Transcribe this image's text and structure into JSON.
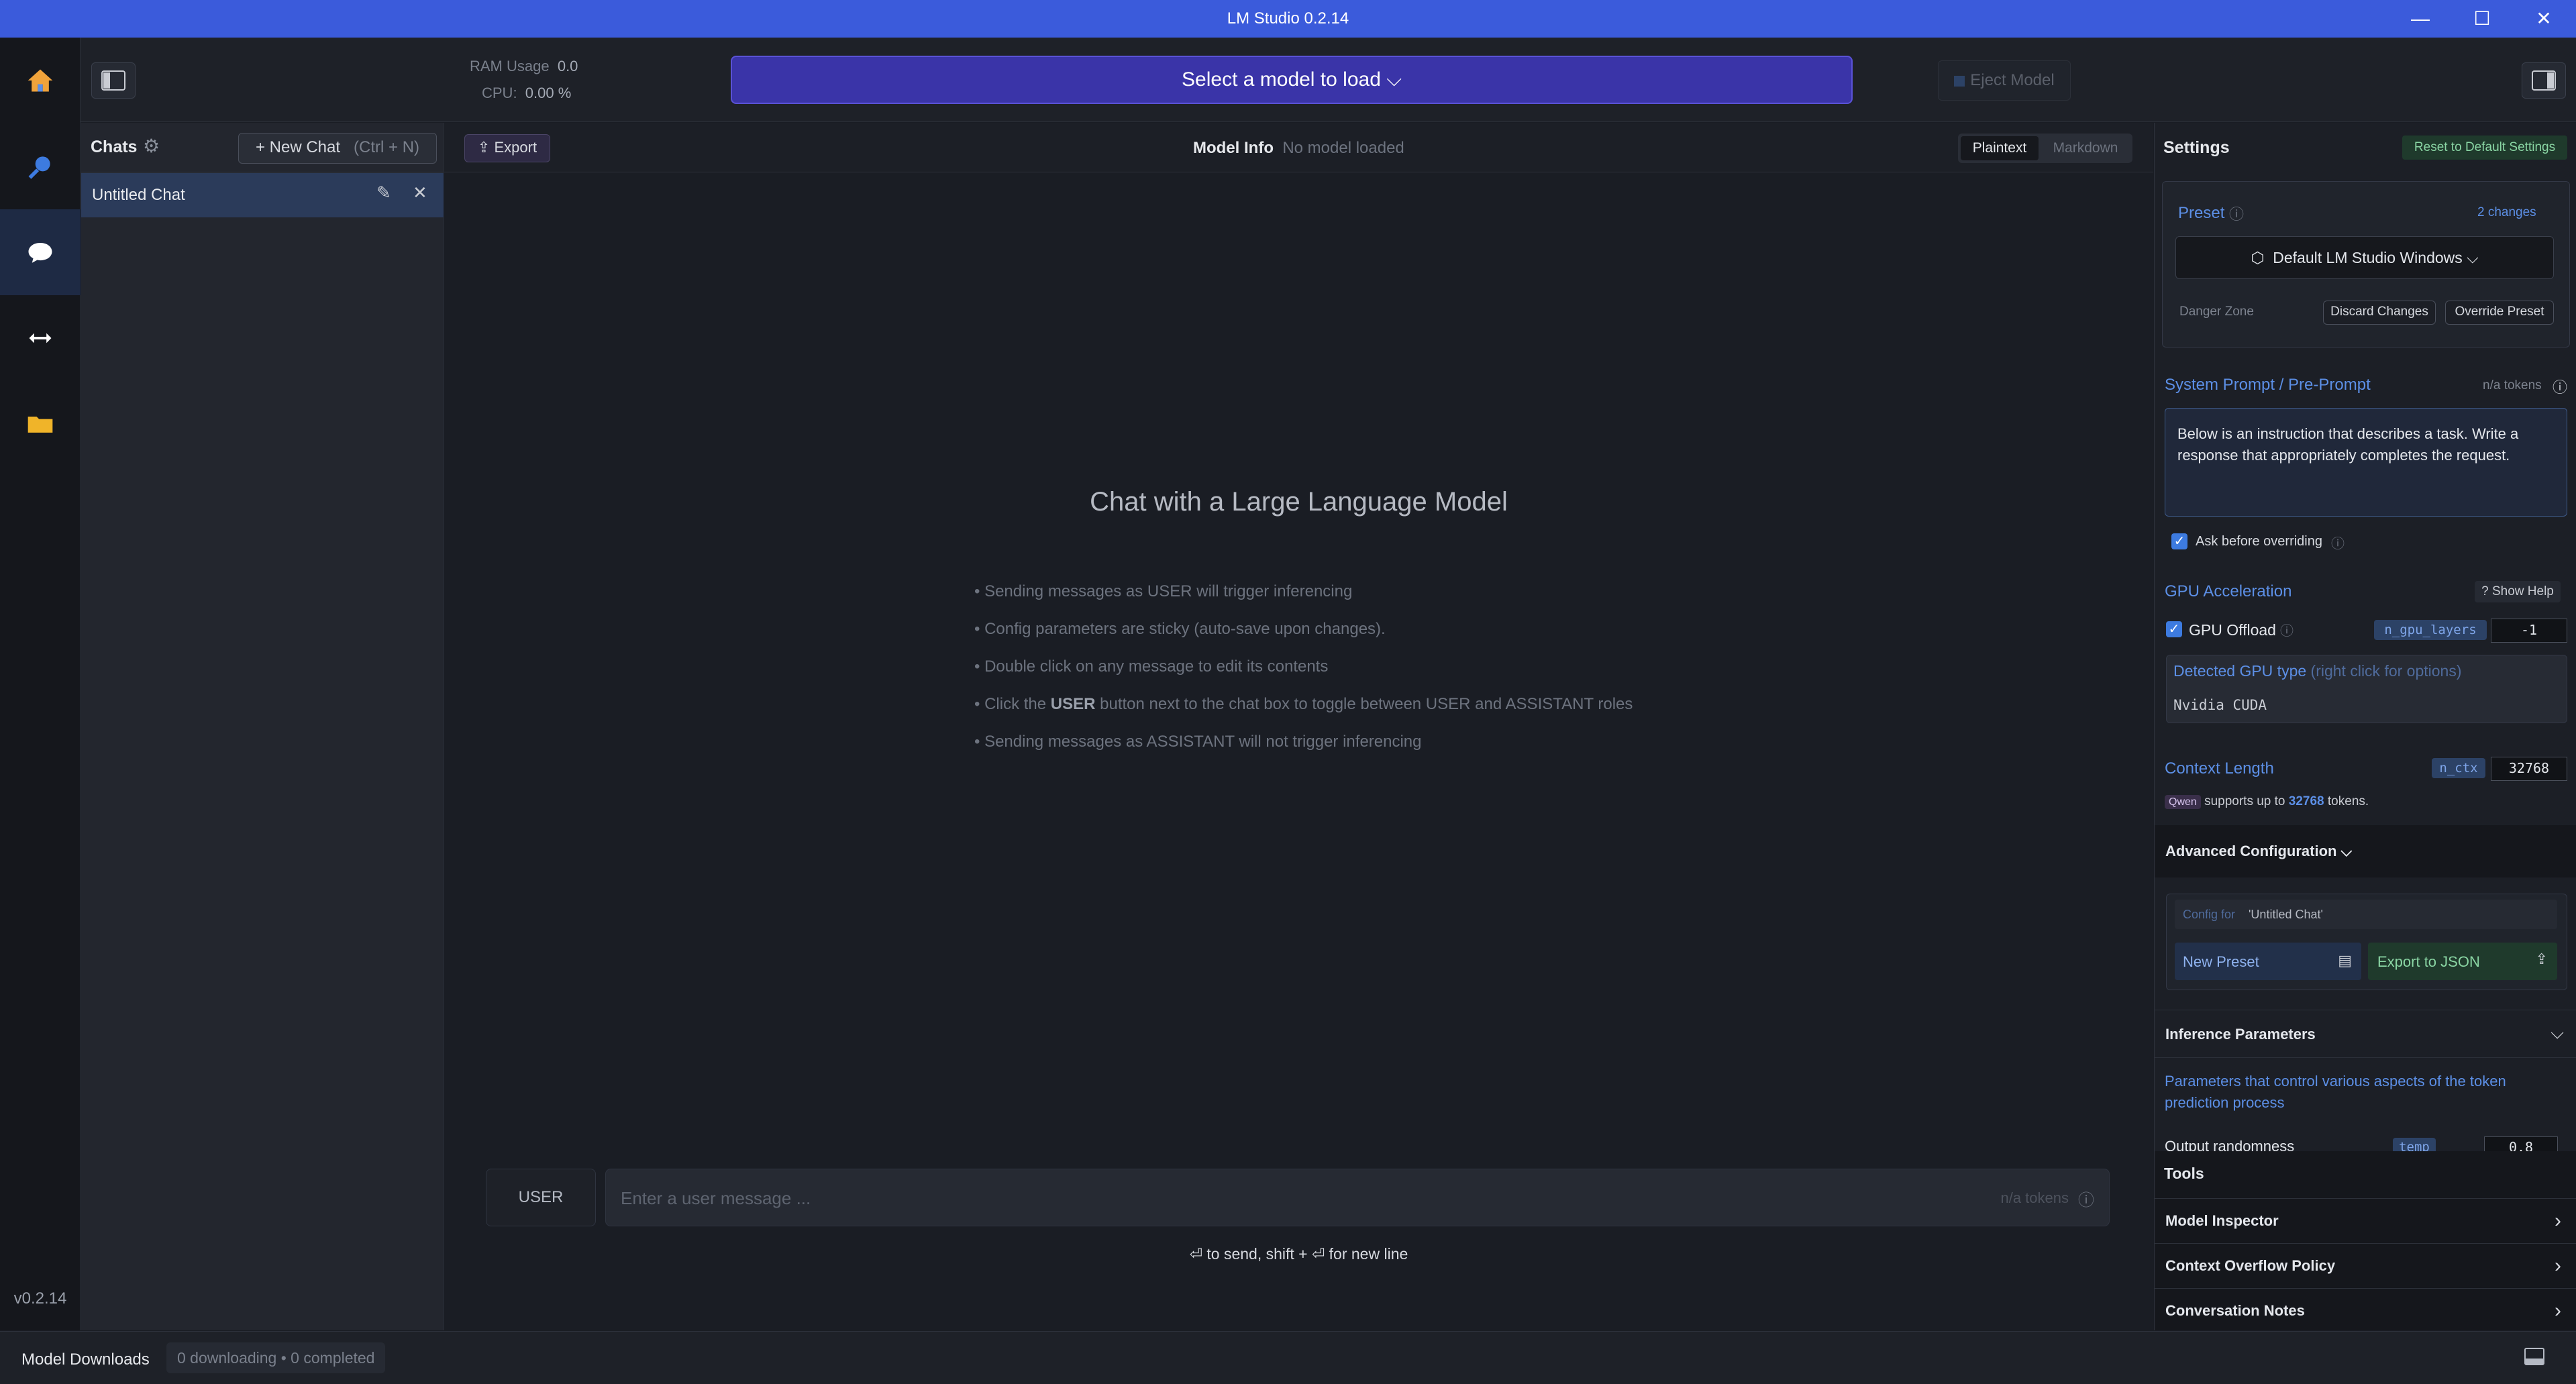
{
  "window": {
    "title": "LM Studio 0.2.14",
    "minimize": "—",
    "maximize": "☐",
    "close": "✕"
  },
  "rail": {
    "version": "v0.2.14"
  },
  "topbar": {
    "ram_label": "RAM Usage",
    "ram_value": "0.0",
    "cpu_label": "CPU:",
    "cpu_value": "0.00 %",
    "select_model": "Select a model to load ⌵",
    "eject": "Eject Model"
  },
  "chats": {
    "title": "Chats",
    "new_chat": "+ New Chat",
    "new_chat_shortcut": "(Ctrl + N)",
    "items": [
      {
        "label": "Untitled Chat"
      }
    ]
  },
  "main": {
    "export": "Export",
    "model_info_label": "Model Info",
    "model_info_value": "No model loaded",
    "format_tabs": [
      "Plaintext",
      "Markdown"
    ],
    "heading": "Chat with a Large Language Model",
    "tips": [
      "• Sending messages as USER will trigger inferencing",
      "• Config parameters are sticky (auto-save upon changes).",
      "• Double click on any message to edit its contents",
      "• Click the ",
      "USER",
      " button next to the chat box to toggle between USER and ASSISTANT roles",
      "• Sending messages as ASSISTANT will not trigger inferencing"
    ],
    "role_button": "USER",
    "input_placeholder": "Enter a user message ...",
    "input_tokens": "n/a tokens",
    "send_hint": "⏎ to send, shift + ⏎ for new line"
  },
  "settings": {
    "title": "Settings",
    "reset": "Reset to Default Settings",
    "preset_label": "Preset",
    "changes": "2 changes",
    "preset_value": "Default LM Studio Windows ⌵",
    "danger_zone": "Danger Zone",
    "discard": "Discard Changes",
    "override": "Override Preset",
    "system_prompt_label": "System Prompt / Pre-Prompt",
    "system_prompt_tokens": "n/a tokens",
    "system_prompt_text": "Below is an instruction that describes a task. Write a response that appropriately completes the request.",
    "ask_before": "Ask before overriding",
    "gpu_accel": "GPU Acceleration",
    "show_help": "Show Help",
    "gpu_offload": "GPU Offload",
    "n_gpu_layers": "n_gpu_layers",
    "gpu_layers_value": "-1",
    "detected_gpu_label": "Detected GPU type",
    "detected_gpu_hint": "(right click for options)",
    "detected_gpu_value": "Nvidia CUDA",
    "context_length": "Context Length",
    "n_ctx": "n_ctx",
    "ctx_value": "32768",
    "ctx_model": "Qwen",
    "ctx_supports": "supports up to",
    "ctx_max": "32768",
    "ctx_tokens": "tokens.",
    "advanced": "Advanced Configuration ⌵",
    "config_for_label": "Config for",
    "config_for_value": "'Untitled Chat'",
    "new_preset": "New Preset",
    "export_json": "Export to JSON",
    "inference": "Inference Parameters",
    "inference_desc": "Parameters that control various aspects of the token prediction process",
    "output_randomness": "Output randomness",
    "temp_tag": "temp",
    "temp_value": "0.8",
    "tools_label": "Tools",
    "tools": [
      "Model Inspector",
      "Context Overflow Policy",
      "Conversation Notes"
    ]
  },
  "bottom": {
    "model_downloads": "Model Downloads",
    "status": "0 downloading • 0 completed"
  }
}
